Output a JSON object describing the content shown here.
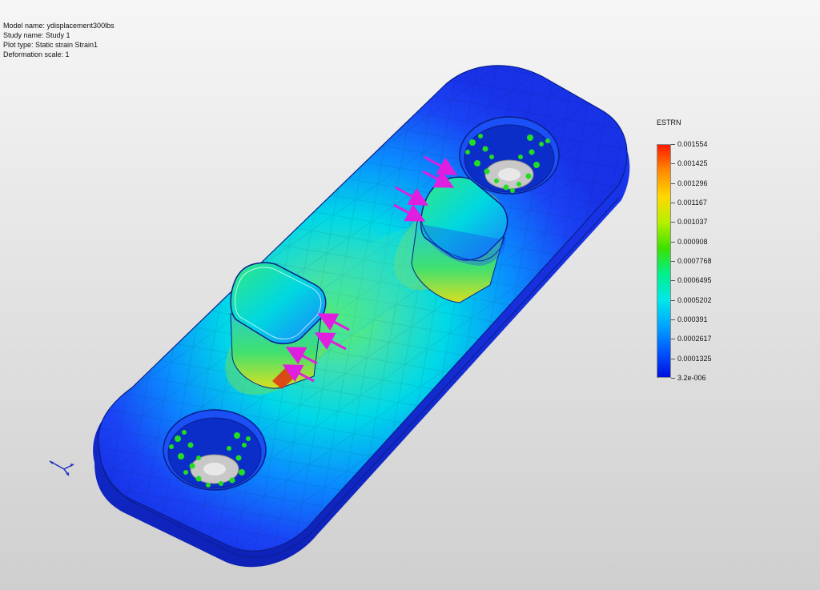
{
  "info": {
    "model_name": "Model name: ydisplacement300lbs",
    "study_name": "Study name: Study 1",
    "plot_type": "Plot type: Static strain Strain1",
    "deformation_scale": "Deformation scale: 1"
  },
  "legend": {
    "title": "ESTRN",
    "labels": [
      "0.001554",
      "0.001425",
      "0.001296",
      "0.001167",
      "0.001037",
      "0.000908",
      "0.0007768",
      "0.0006495",
      "0.0005202",
      "0.000391",
      "0.0002617",
      "0.0001325",
      "3.2e-006"
    ],
    "colors": [
      "#ff1a00",
      "#ff8a00",
      "#ffd800",
      "#b6f000",
      "#3ee000",
      "#00f08a",
      "#00e8e8",
      "#00a6ff",
      "#0058ff",
      "#0010e0"
    ]
  },
  "model": {
    "body_color": "#1a3cf0",
    "edge_color": "#0a1f8c",
    "fixture_color": "#22dd22",
    "load_color": "#e01ee0",
    "hole_inner_color": "#c8c8c8"
  }
}
